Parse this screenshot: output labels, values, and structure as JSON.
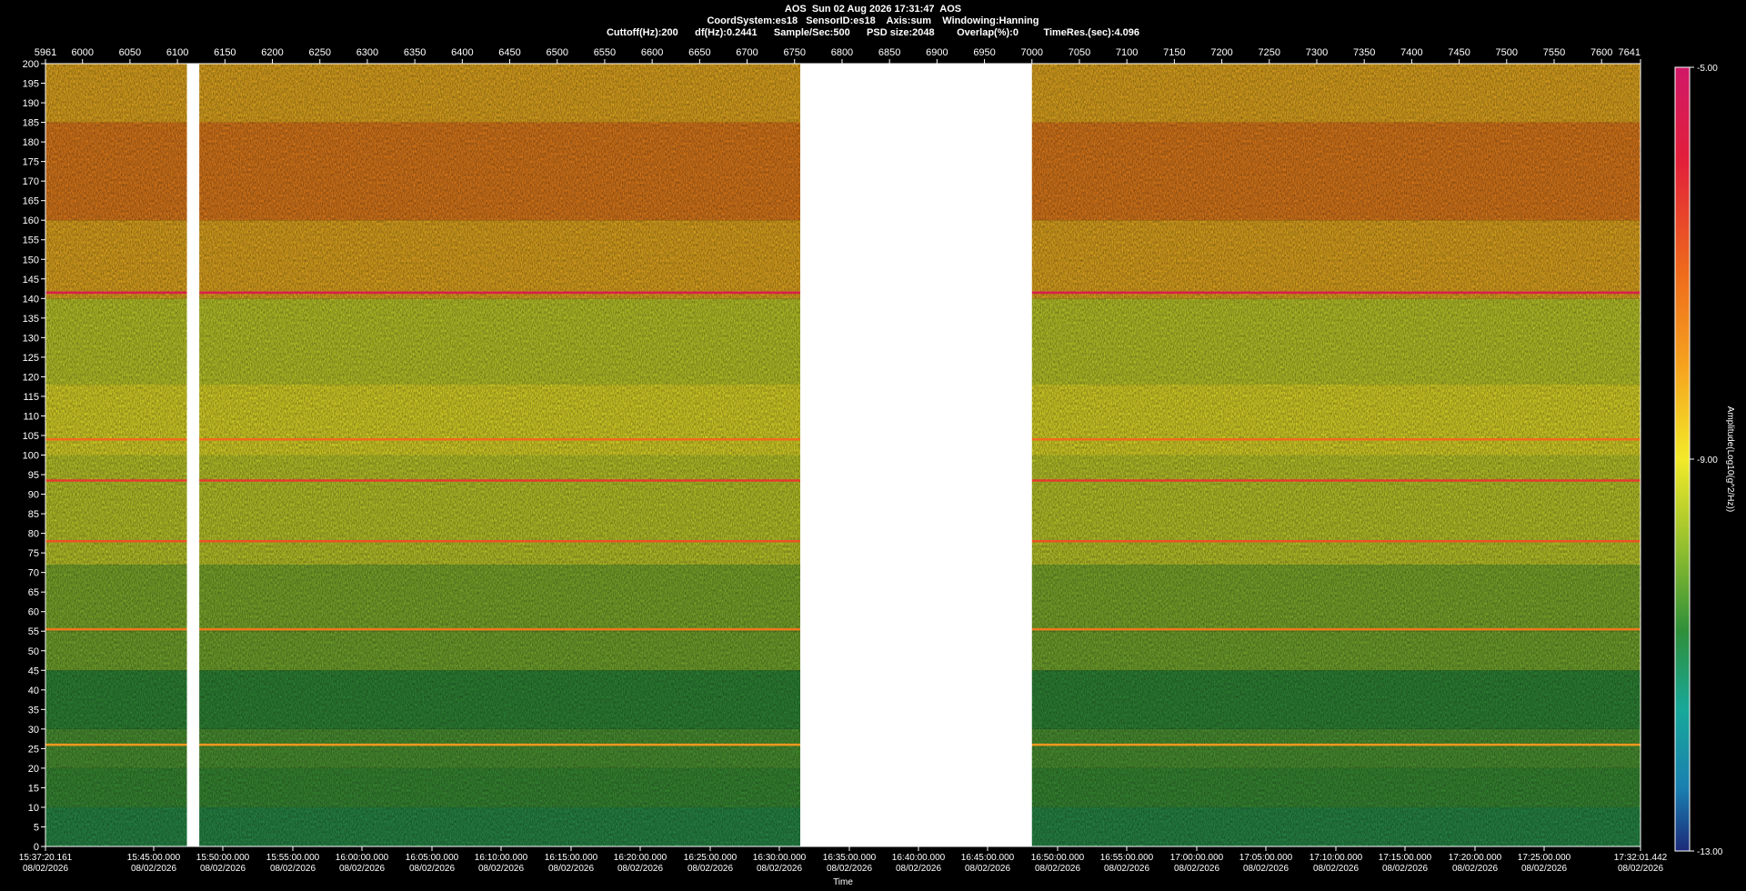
{
  "header": {
    "title": "AOS  Sun 02 Aug 2026 17:31:47  AOS",
    "line2": "CoordSystem:es18   SensorID:es18    Axis:sum    Windowing:Hanning",
    "line3": "Cuttoff(Hz):200      df(Hz):0.2441      Sample/Sec:500      PSD size:2048        Overlap(%):0         TimeRes.(sec):4.096"
  },
  "chart_data": {
    "type": "heatmap",
    "xlabel": "Time",
    "ylabel": "",
    "colorbar_label": "Amplitude(Log10(g^2/Hz))",
    "colorbar_ticks": [
      "-5.00",
      "-9.00",
      "-13.00"
    ],
    "colorbar_range": [
      -13,
      -5
    ],
    "ylim": [
      0,
      200
    ],
    "y_ticks": [
      200,
      195,
      190,
      185,
      180,
      175,
      170,
      165,
      160,
      155,
      150,
      145,
      140,
      135,
      130,
      125,
      120,
      115,
      110,
      105,
      100,
      95,
      90,
      85,
      80,
      75,
      70,
      65,
      60,
      55,
      50,
      45,
      40,
      35,
      30,
      25,
      20,
      15,
      10,
      5,
      0
    ],
    "top_axis": {
      "range": [
        5961,
        7641
      ],
      "ticks": [
        "5961",
        "6000",
        "6050",
        "6100",
        "6150",
        "6200",
        "6250",
        "6300",
        "6350",
        "6400",
        "6450",
        "6500",
        "6550",
        "6600",
        "6650",
        "6700",
        "6750",
        "6800",
        "6850",
        "6900",
        "6950",
        "7000",
        "7050",
        "7100",
        "7150",
        "7200",
        "7250",
        "7300",
        "7350",
        "7400",
        "7450",
        "7500",
        "7550",
        "7600",
        "7641"
      ]
    },
    "x_ticks": [
      {
        "time": "15:37:20.161",
        "date": "08/02/2026"
      },
      {
        "time": "15:45:00.000",
        "date": "08/02/2026"
      },
      {
        "time": "15:50:00.000",
        "date": "08/02/2026"
      },
      {
        "time": "15:55:00.000",
        "date": "08/02/2026"
      },
      {
        "time": "16:00:00.000",
        "date": "08/02/2026"
      },
      {
        "time": "16:05:00.000",
        "date": "08/02/2026"
      },
      {
        "time": "16:10:00.000",
        "date": "08/02/2026"
      },
      {
        "time": "16:15:00.000",
        "date": "08/02/2026"
      },
      {
        "time": "16:20:00.000",
        "date": "08/02/2026"
      },
      {
        "time": "16:25:00.000",
        "date": "08/02/2026"
      },
      {
        "time": "16:30:00.000",
        "date": "08/02/2026"
      },
      {
        "time": "16:35:00.000",
        "date": "08/02/2026"
      },
      {
        "time": "16:40:00.000",
        "date": "08/02/2026"
      },
      {
        "time": "16:45:00.000",
        "date": "08/02/2026"
      },
      {
        "time": "16:50:00.000",
        "date": "08/02/2026"
      },
      {
        "time": "16:55:00.000",
        "date": "08/02/2026"
      },
      {
        "time": "17:00:00.000",
        "date": "08/02/2026"
      },
      {
        "time": "17:05:00.000",
        "date": "08/02/2026"
      },
      {
        "time": "17:10:00.000",
        "date": "08/02/2026"
      },
      {
        "time": "17:15:00.000",
        "date": "08/02/2026"
      },
      {
        "time": "17:20:00.000",
        "date": "08/02/2026"
      },
      {
        "time": "17:25:00.000",
        "date": "08/02/2026"
      },
      {
        "time": "17:32:01.442",
        "date": "08/02/2026"
      }
    ],
    "data_gaps_x": [
      [
        6110,
        6123
      ],
      [
        6756,
        7000
      ]
    ],
    "bands": [
      {
        "from": 0,
        "to": 10,
        "value": -10.5
      },
      {
        "from": 10,
        "to": 20,
        "value": -10.2
      },
      {
        "from": 20,
        "to": 30,
        "value": -10.0
      },
      {
        "from": 30,
        "to": 45,
        "value": -10.3
      },
      {
        "from": 45,
        "to": 55,
        "value": -9.6
      },
      {
        "from": 55,
        "to": 72,
        "value": -9.5
      },
      {
        "from": 72,
        "to": 100,
        "value": -8.9
      },
      {
        "from": 100,
        "to": 118,
        "value": -8.6
      },
      {
        "from": 118,
        "to": 140,
        "value": -8.9
      },
      {
        "from": 140,
        "to": 160,
        "value": -7.9
      },
      {
        "from": 160,
        "to": 185,
        "value": -7.2
      },
      {
        "from": 185,
        "to": 200,
        "value": -7.9
      }
    ],
    "lines": [
      {
        "freq": 141.5,
        "value": -5.5
      },
      {
        "freq": 93.5,
        "value": -6.2
      },
      {
        "freq": 78,
        "value": -6.5
      },
      {
        "freq": 55.5,
        "value": -7.0
      },
      {
        "freq": 26,
        "value": -7.5
      },
      {
        "freq": 104,
        "value": -6.8
      }
    ],
    "colors": {
      "background": "#000000",
      "gap": "#ffffff",
      "text": "#ffffff",
      "scale": [
        "#1c2a7a",
        "#1a7fb0",
        "#18a89a",
        "#2e8f3a",
        "#8cbc2e",
        "#f3ea2a",
        "#f6a21e",
        "#ee6a1c",
        "#e2203a",
        "#d01868"
      ]
    }
  }
}
